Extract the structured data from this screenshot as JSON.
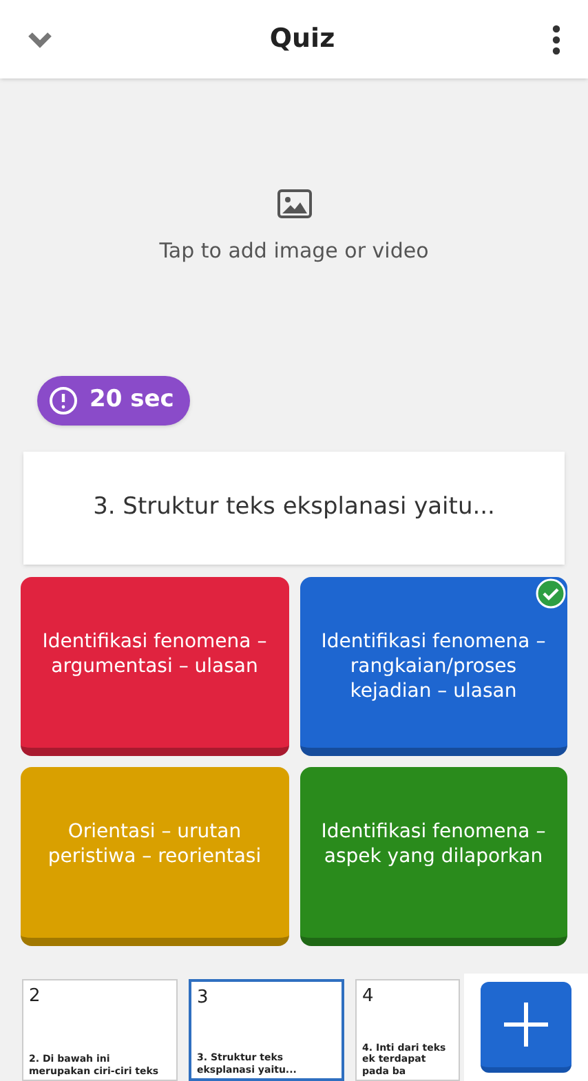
{
  "header": {
    "title": "Quiz"
  },
  "media": {
    "placeholder": "Tap to add image or video"
  },
  "timer": {
    "label": "20 sec"
  },
  "question": {
    "text": "3. Struktur teks eksplanasi yaitu..."
  },
  "answers": [
    {
      "text": "Identifikasi fenomena – argumentasi – ulasan",
      "color": "#e0233f",
      "correct": false
    },
    {
      "text": "Identifikasi fenomena – rangkaian/proses kejadian – ulasan",
      "color": "#1e66d0",
      "correct": true
    },
    {
      "text": "Orientasi – urutan peristiwa – reorientasi",
      "color": "#d9a000",
      "correct": false
    },
    {
      "text": "Identifikasi fenomena – aspek yang dilaporkan",
      "color": "#2a8b1c",
      "correct": false
    }
  ],
  "slides": [
    {
      "number": "2",
      "text": "2. Di bawah ini merupakan ciri-ciri teks",
      "selected": false
    },
    {
      "number": "3",
      "text": "3. Struktur teks eksplanasi yaitu...",
      "selected": true
    },
    {
      "number": "4",
      "text": "4. Inti dari teks ek terdapat pada ba",
      "selected": false
    }
  ]
}
